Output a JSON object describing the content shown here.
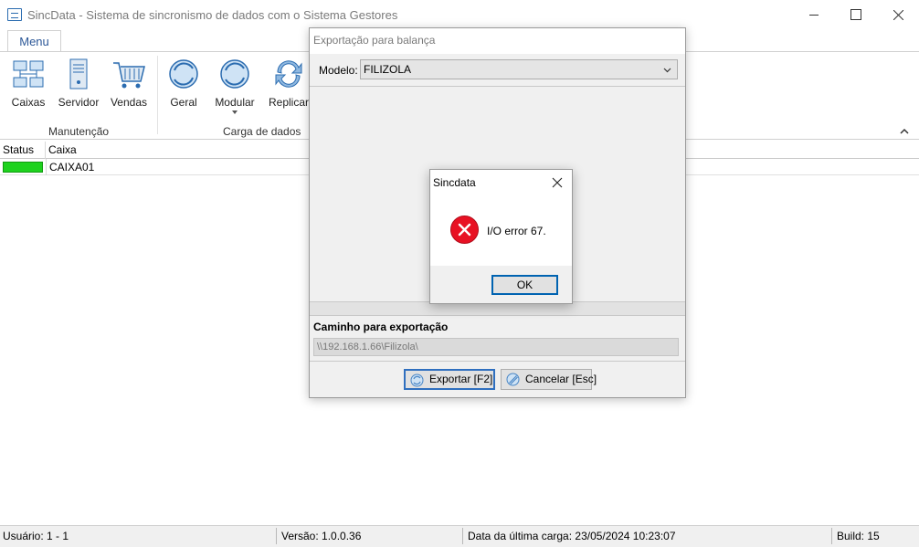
{
  "window": {
    "title": "SincData - Sistema de sincronismo de dados com o Sistema Gestores"
  },
  "ribbon": {
    "tab": "Menu",
    "groups": [
      {
        "label": "Manutenção",
        "buttons": [
          "Caixas",
          "Servidor",
          "Vendas"
        ]
      },
      {
        "label": "Carga de dados",
        "buttons": [
          "Geral",
          "Modular",
          "Replicar"
        ]
      }
    ]
  },
  "grid": {
    "columns": [
      "Status",
      "Caixa"
    ],
    "rows": [
      {
        "status_color": "#1ed21e",
        "caixa": "CAIXA01"
      }
    ]
  },
  "statusbar": {
    "usuario": "Usuário: 1 - 1",
    "versao": "Versão: 1.0.0.36",
    "ultima_carga": "Data da última carga: 23/05/2024 10:23:07",
    "build": "Build: 15"
  },
  "export_dialog": {
    "title": "Exportação para balança",
    "model_label": "Modelo:",
    "model_value": "FILIZOLA",
    "path_label": "Caminho para exportação",
    "path_value": "\\\\192.168.1.66\\Filizola\\",
    "export_button": "Exportar [F2]",
    "cancel_button": "Cancelar [Esc]"
  },
  "message_box": {
    "title": "Sincdata",
    "text": "I/O error 67.",
    "ok_button": "OK",
    "icon": "error-icon",
    "icon_color": "#e81123"
  }
}
